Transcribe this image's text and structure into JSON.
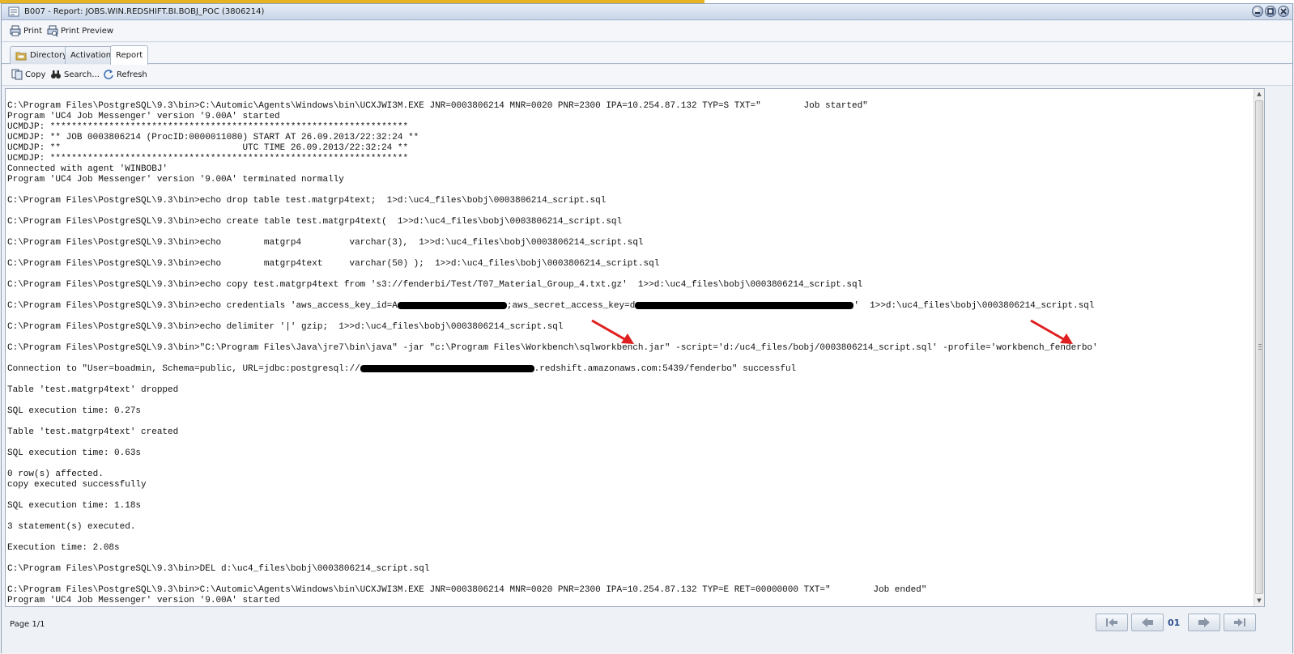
{
  "window": {
    "title": "B007 - Report: JOBS.WIN.REDSHIFT.BI.BOBJ_POC (3806214)"
  },
  "toolbar": {
    "print_label": "Print",
    "print_preview_label": "Print Preview"
  },
  "tabs": [
    {
      "label": "Directory",
      "active": false
    },
    {
      "label": "Activation",
      "active": false
    },
    {
      "label": "Report",
      "active": true
    }
  ],
  "report_toolbar": {
    "copy_label": "Copy",
    "search_label": "Search...",
    "refresh_label": "Refresh"
  },
  "report": {
    "lines": [
      "C:\\Program Files\\PostgreSQL\\9.3\\bin>C:\\Automic\\Agents\\Windows\\bin\\UCXJWI3M.EXE JNR=0003806214 MNR=0020 PNR=2300 IPA=10.254.87.132 TYP=S TXT=\"        Job started\"",
      "Program 'UC4 Job Messenger' version '9.00A' started",
      "UCMDJP: *******************************************************************",
      "UCMDJP: ** JOB 0003806214 (ProcID:0000011080) START AT 26.09.2013/22:32:24 **",
      "UCMDJP: **                                  UTC TIME 26.09.2013/22:32:24 **",
      "UCMDJP: *******************************************************************",
      "Connected with agent 'WINBOBJ'",
      "Program 'UC4 Job Messenger' version '9.00A' terminated normally",
      "",
      "C:\\Program Files\\PostgreSQL\\9.3\\bin>echo drop table test.matgrp4text;  1>d:\\uc4_files\\bobj\\0003806214_script.sql",
      "",
      "C:\\Program Files\\PostgreSQL\\9.3\\bin>echo create table test.matgrp4text(  1>>d:\\uc4_files\\bobj\\0003806214_script.sql",
      "",
      "C:\\Program Files\\PostgreSQL\\9.3\\bin>echo        matgrp4         varchar(3),  1>>d:\\uc4_files\\bobj\\0003806214_script.sql",
      "",
      "C:\\Program Files\\PostgreSQL\\9.3\\bin>echo        matgrp4text     varchar(50) );  1>>d:\\uc4_files\\bobj\\0003806214_script.sql",
      "",
      "C:\\Program Files\\PostgreSQL\\9.3\\bin>echo copy test.matgrp4text from 's3://fenderbi/Test/T07_Material_Group_4.txt.gz'  1>>d:\\uc4_files\\bobj\\0003806214_script.sql",
      "",
      "CREDENTIALS_LINE",
      "",
      "C:\\Program Files\\PostgreSQL\\9.3\\bin>echo delimiter '|' gzip;  1>>d:\\uc4_files\\bobj\\0003806214_script.sql",
      "",
      "C:\\Program Files\\PostgreSQL\\9.3\\bin>\"C:\\Program Files\\Java\\jre7\\bin\\java\" -jar \"c:\\Program Files\\Workbench\\sqlworkbench.jar\" -script='d:/uc4_files/bobj/0003806214_script.sql' -profile='workbench_fenderbo'",
      "",
      "CONNECTION_LINE",
      "",
      "Table 'test.matgrp4text' dropped",
      "",
      "SQL execution time: 0.27s",
      "",
      "Table 'test.matgrp4text' created",
      "",
      "SQL execution time: 0.63s",
      "",
      "0 row(s) affected.",
      "copy executed successfully",
      "",
      "SQL execution time: 1.18s",
      "",
      "3 statement(s) executed.",
      "",
      "Execution time: 2.08s",
      "",
      "C:\\Program Files\\PostgreSQL\\9.3\\bin>DEL d:\\uc4_files\\bobj\\0003806214_script.sql",
      "",
      "C:\\Program Files\\PostgreSQL\\9.3\\bin>C:\\Automic\\Agents\\Windows\\bin\\UCXJWI3M.EXE JNR=0003806214 MNR=0020 PNR=2300 IPA=10.254.87.132 TYP=E RET=00000000 TXT=\"        Job ended\"",
      "Program 'UC4 Job Messenger' version '9.00A' started"
    ],
    "credentials_line": {
      "prefix": "C:\\Program Files\\PostgreSQL\\9.3\\bin>echo credentials 'aws_access_key_id=A",
      "middle": ";aws_secret_access_key=d",
      "suffix": "'  1>>d:\\uc4_files\\bobj\\0003806214_script.sql"
    },
    "connection_line": {
      "prefix": "Connection to \"User=boadmin, Schema=public, URL=jdbc:postgresql://",
      "suffix": ".redshift.amazonaws.com:5439/fenderbo\" successful"
    }
  },
  "status": {
    "page_label": "Page 1/1",
    "page_number": "01"
  },
  "colors": {
    "annotation_arrow": "#e02020",
    "title_accent": "#e6b422"
  }
}
